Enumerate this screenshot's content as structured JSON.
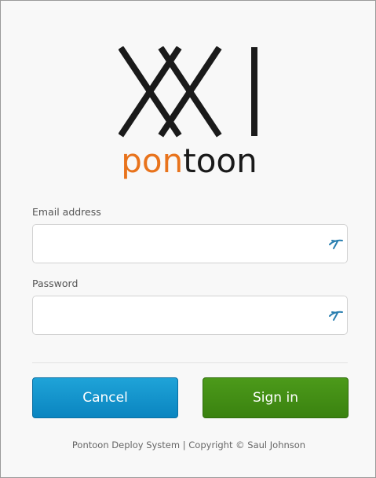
{
  "brand": {
    "logo_name": "pontoon",
    "logo_name_highlight": "pon",
    "logo_name_rest": "toon",
    "highlight_color": "#e8731c",
    "dark_color": "#1a1a1a"
  },
  "form": {
    "email_label": "Email address",
    "email_value": "",
    "password_label": "Password",
    "password_value": "",
    "field_icon": "password-manager-icon"
  },
  "buttons": {
    "cancel_label": "Cancel",
    "signin_label": "Sign in",
    "cancel_color": "#0f8cc6",
    "signin_color": "#438e15"
  },
  "footer": {
    "text": "Pontoon Deploy System | Copyright © Saul Johnson"
  }
}
